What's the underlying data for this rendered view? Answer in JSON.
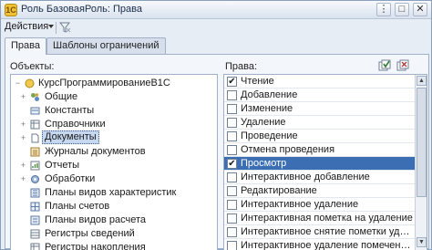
{
  "window": {
    "title": "Роль БазоваяРоль: Права",
    "app_icon": "1С"
  },
  "window_buttons": {
    "more": "⋮",
    "maximize": "□",
    "close": "✕"
  },
  "toolbar": {
    "actions_label": "Действия",
    "filter_icon": "filter-funnel-icon"
  },
  "tabs": [
    {
      "label": "Права",
      "active": true
    },
    {
      "label": "Шаблоны ограничений",
      "active": false
    }
  ],
  "objects_pane": {
    "label": "Объекты:",
    "items": [
      {
        "label": "КурсПрограммированиеВ1С",
        "icon": "config-dot",
        "expander": "−",
        "level": 0
      },
      {
        "label": "Общие",
        "icon": "gear-cluster",
        "expander": "+",
        "level": 1
      },
      {
        "label": "Константы",
        "icon": "constant",
        "expander": "",
        "level": 1
      },
      {
        "label": "Справочники",
        "icon": "catalog",
        "expander": "+",
        "level": 1
      },
      {
        "label": "Документы",
        "icon": "document",
        "expander": "+",
        "level": 1,
        "selected": true
      },
      {
        "label": "Журналы документов",
        "icon": "journal",
        "expander": "",
        "level": 1
      },
      {
        "label": "Отчеты",
        "icon": "report",
        "expander": "+",
        "level": 1
      },
      {
        "label": "Обработки",
        "icon": "processing",
        "expander": "+",
        "level": 1
      },
      {
        "label": "Планы видов характеристик",
        "icon": "chart-of-chars",
        "expander": "",
        "level": 1
      },
      {
        "label": "Планы счетов",
        "icon": "chart-of-accounts",
        "expander": "",
        "level": 1
      },
      {
        "label": "Планы видов расчета",
        "icon": "calc-types",
        "expander": "",
        "level": 1
      },
      {
        "label": "Регистры сведений",
        "icon": "info-register",
        "expander": "",
        "level": 1
      },
      {
        "label": "Регистры накопления",
        "icon": "accum-register",
        "expander": "",
        "level": 1
      },
      {
        "label": "",
        "icon": "partial",
        "expander": "",
        "level": 1
      }
    ]
  },
  "rights_pane": {
    "label": "Права:",
    "items": [
      {
        "label": "Чтение",
        "checked": true
      },
      {
        "label": "Добавление",
        "checked": false
      },
      {
        "label": "Изменение",
        "checked": false
      },
      {
        "label": "Удаление",
        "checked": false
      },
      {
        "label": "Проведение",
        "checked": false
      },
      {
        "label": "Отмена проведения",
        "checked": false
      },
      {
        "label": "Просмотр",
        "checked": true,
        "selected": true
      },
      {
        "label": "Интерактивное добавление",
        "checked": false
      },
      {
        "label": "Редактирование",
        "checked": false
      },
      {
        "label": "Интерактивное удаление",
        "checked": false
      },
      {
        "label": "Интерактивная пометка на удаление",
        "checked": false
      },
      {
        "label": "Интерактивное снятие пометки удале...",
        "checked": false
      },
      {
        "label": "Интерактивное удаление помеченных",
        "checked": false
      }
    ]
  },
  "colors": {
    "selection": "#3c6eb4",
    "tree_selection": "#c6d8f0",
    "frame": "#9fb0c8"
  }
}
